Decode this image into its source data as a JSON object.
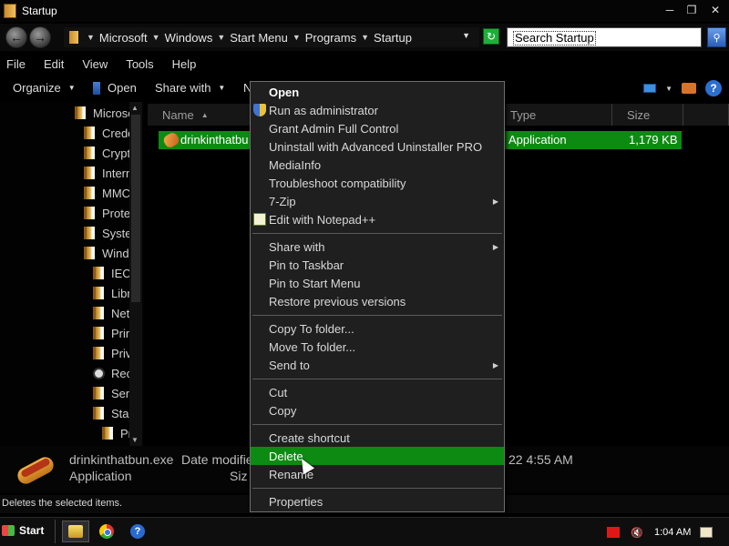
{
  "window": {
    "title": "Startup"
  },
  "address": {
    "crumbs": [
      "Microsoft",
      "Windows",
      "Start Menu",
      "Programs",
      "Startup"
    ],
    "search_placeholder": "Search Startup"
  },
  "menubar": [
    "File",
    "Edit",
    "View",
    "Tools",
    "Help"
  ],
  "toolbar": {
    "organize": "Organize",
    "open": "Open",
    "share_with": "Share with",
    "partial": "N"
  },
  "nav_tree": [
    {
      "label": "Microsc",
      "icon": "folder-icon"
    },
    {
      "label": "Crede",
      "icon": "folder-icon"
    },
    {
      "label": "Crypt",
      "icon": "folder-icon"
    },
    {
      "label": "Intern",
      "icon": "folder-icon"
    },
    {
      "label": "MMC",
      "icon": "folder-icon"
    },
    {
      "label": "Prote",
      "icon": "folder-icon"
    },
    {
      "label": "Syste",
      "icon": "folder-icon"
    },
    {
      "label": "Windo",
      "icon": "folder-icon"
    },
    {
      "label": "IEC",
      "icon": "folder-icon"
    },
    {
      "label": "Libr",
      "icon": "folder-icon"
    },
    {
      "label": "Net",
      "icon": "folder-icon"
    },
    {
      "label": "Prin",
      "icon": "folder-icon"
    },
    {
      "label": "Priv",
      "icon": "folder-icon"
    },
    {
      "label": "Rec",
      "icon": "recent-icon"
    },
    {
      "label": "Sen",
      "icon": "folder-icon"
    },
    {
      "label": "Sta",
      "icon": "folder-icon"
    },
    {
      "label": "Pr",
      "icon": "folder-icon"
    }
  ],
  "columns": {
    "name": "Name",
    "type": "Type",
    "size": "Size"
  },
  "file_row": {
    "name": "drinkinthatbu",
    "type": "Application",
    "size": "1,179 KB"
  },
  "context_menu": {
    "groups": [
      [
        {
          "label": "Open",
          "bold": true
        },
        {
          "label": "Run as administrator",
          "icon": "shield-icon"
        },
        {
          "label": "Grant Admin Full Control"
        },
        {
          "label": "Uninstall with Advanced Uninstaller PRO"
        },
        {
          "label": "MediaInfo"
        },
        {
          "label": "Troubleshoot compatibility"
        },
        {
          "label": "7-Zip",
          "submenu": true
        },
        {
          "label": "Edit with Notepad++",
          "icon": "notepad-icon"
        }
      ],
      [
        {
          "label": "Share with",
          "submenu": true
        },
        {
          "label": "Pin to Taskbar"
        },
        {
          "label": "Pin to Start Menu"
        },
        {
          "label": "Restore previous versions"
        }
      ],
      [
        {
          "label": "Copy To folder..."
        },
        {
          "label": "Move To folder..."
        },
        {
          "label": "Send to",
          "submenu": true
        }
      ],
      [
        {
          "label": "Cut"
        },
        {
          "label": "Copy"
        }
      ],
      [
        {
          "label": "Create shortcut"
        },
        {
          "label": "Delete",
          "highlight": true
        },
        {
          "label": "Rename"
        }
      ],
      [
        {
          "label": "Properties"
        }
      ]
    ]
  },
  "details": {
    "filename": "drinkinthatbun.exe",
    "date_label": "Date modifie",
    "date_tail": "22 4:55 AM",
    "type": "Application",
    "size_label": "Siz"
  },
  "status": {
    "text": "Deletes the selected items."
  },
  "taskbar": {
    "start": "Start",
    "clock": "1:04 AM"
  },
  "colors": {
    "selection": "#0d8a12",
    "background": "#000000",
    "menu": "#1f1f1f"
  }
}
